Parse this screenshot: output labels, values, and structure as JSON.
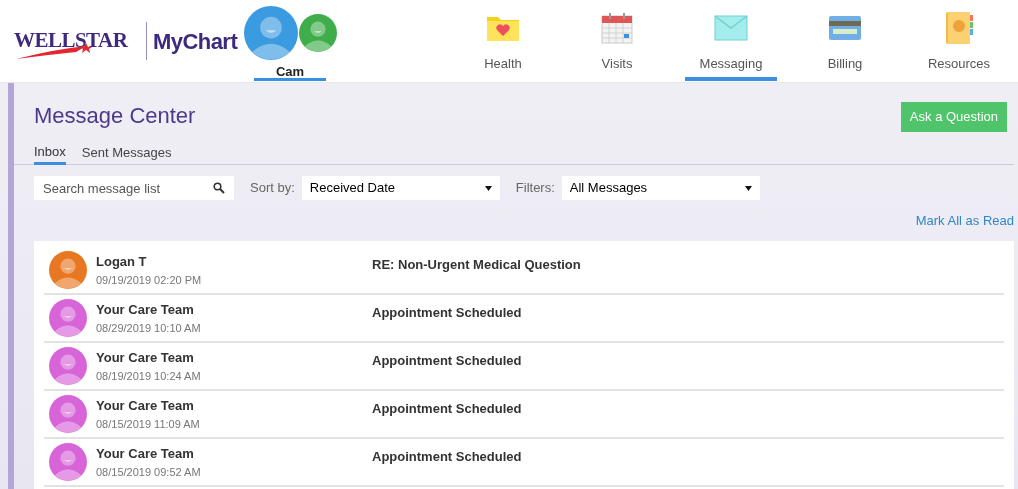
{
  "header": {
    "logo_text": "WELLSTAR",
    "app_name": "MyChart",
    "accounts": [
      {
        "name": "Cam",
        "selected": true,
        "color": "#3b9be0"
      },
      {
        "color": "#3fae4a"
      }
    ],
    "nav": [
      {
        "label": "Health",
        "kind": "health",
        "selected": false
      },
      {
        "label": "Visits",
        "kind": "visits",
        "selected": false
      },
      {
        "label": "Messaging",
        "kind": "messaging",
        "selected": true
      },
      {
        "label": "Billing",
        "kind": "billing",
        "selected": false
      },
      {
        "label": "Resources",
        "kind": "resources",
        "selected": false
      }
    ]
  },
  "page": {
    "title": "Message Center",
    "ask_button": "Ask a Question",
    "tabs": [
      {
        "label": "Inbox",
        "selected": true
      },
      {
        "label": "Sent Messages",
        "selected": false
      }
    ],
    "search": {
      "placeholder": "Search message list"
    },
    "sort": {
      "label": "Sort by:",
      "value": "Received Date"
    },
    "filter": {
      "label": "Filters:",
      "value": "All Messages"
    },
    "mark_all": "Mark All as Read",
    "messages": [
      {
        "sender": "Logan T",
        "date": "09/19/2019 02:20 PM",
        "subject": "RE: Non-Urgent Medical Question",
        "color": "#e87722"
      },
      {
        "sender": "Your Care Team",
        "date": "08/29/2019 10:10 AM",
        "subject": "Appointment Scheduled",
        "color": "#d865d8"
      },
      {
        "sender": "Your Care Team",
        "date": "08/19/2019 10:24 AM",
        "subject": "Appointment Scheduled",
        "color": "#d865d8"
      },
      {
        "sender": "Your Care Team",
        "date": "08/15/2019 11:09 AM",
        "subject": "Appointment Scheduled",
        "color": "#d865d8"
      },
      {
        "sender": "Your Care Team",
        "date": "08/15/2019 09:52 AM",
        "subject": "Appointment Scheduled",
        "color": "#d865d8"
      }
    ]
  }
}
